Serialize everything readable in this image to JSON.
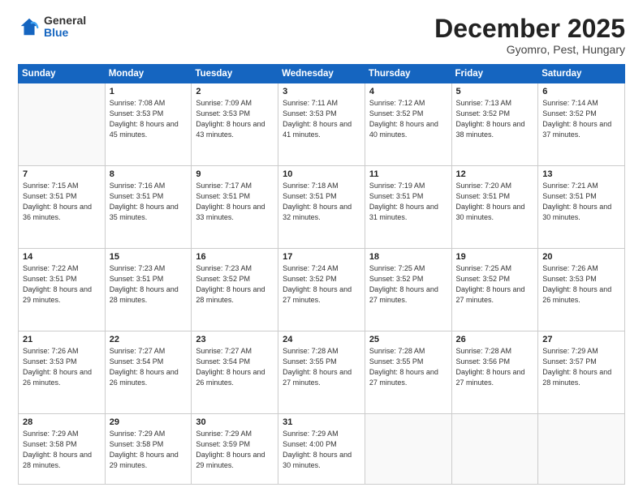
{
  "logo": {
    "general": "General",
    "blue": "Blue"
  },
  "header": {
    "month": "December 2025",
    "location": "Gyomro, Pest, Hungary"
  },
  "weekdays": [
    "Sunday",
    "Monday",
    "Tuesday",
    "Wednesday",
    "Thursday",
    "Friday",
    "Saturday"
  ],
  "weeks": [
    [
      {
        "day": "",
        "sunrise": "",
        "sunset": "",
        "daylight": "",
        "empty": true
      },
      {
        "day": "1",
        "sunrise": "Sunrise: 7:08 AM",
        "sunset": "Sunset: 3:53 PM",
        "daylight": "Daylight: 8 hours and 45 minutes."
      },
      {
        "day": "2",
        "sunrise": "Sunrise: 7:09 AM",
        "sunset": "Sunset: 3:53 PM",
        "daylight": "Daylight: 8 hours and 43 minutes."
      },
      {
        "day": "3",
        "sunrise": "Sunrise: 7:11 AM",
        "sunset": "Sunset: 3:53 PM",
        "daylight": "Daylight: 8 hours and 41 minutes."
      },
      {
        "day": "4",
        "sunrise": "Sunrise: 7:12 AM",
        "sunset": "Sunset: 3:52 PM",
        "daylight": "Daylight: 8 hours and 40 minutes."
      },
      {
        "day": "5",
        "sunrise": "Sunrise: 7:13 AM",
        "sunset": "Sunset: 3:52 PM",
        "daylight": "Daylight: 8 hours and 38 minutes."
      },
      {
        "day": "6",
        "sunrise": "Sunrise: 7:14 AM",
        "sunset": "Sunset: 3:52 PM",
        "daylight": "Daylight: 8 hours and 37 minutes."
      }
    ],
    [
      {
        "day": "7",
        "sunrise": "Sunrise: 7:15 AM",
        "sunset": "Sunset: 3:51 PM",
        "daylight": "Daylight: 8 hours and 36 minutes."
      },
      {
        "day": "8",
        "sunrise": "Sunrise: 7:16 AM",
        "sunset": "Sunset: 3:51 PM",
        "daylight": "Daylight: 8 hours and 35 minutes."
      },
      {
        "day": "9",
        "sunrise": "Sunrise: 7:17 AM",
        "sunset": "Sunset: 3:51 PM",
        "daylight": "Daylight: 8 hours and 33 minutes."
      },
      {
        "day": "10",
        "sunrise": "Sunrise: 7:18 AM",
        "sunset": "Sunset: 3:51 PM",
        "daylight": "Daylight: 8 hours and 32 minutes."
      },
      {
        "day": "11",
        "sunrise": "Sunrise: 7:19 AM",
        "sunset": "Sunset: 3:51 PM",
        "daylight": "Daylight: 8 hours and 31 minutes."
      },
      {
        "day": "12",
        "sunrise": "Sunrise: 7:20 AM",
        "sunset": "Sunset: 3:51 PM",
        "daylight": "Daylight: 8 hours and 30 minutes."
      },
      {
        "day": "13",
        "sunrise": "Sunrise: 7:21 AM",
        "sunset": "Sunset: 3:51 PM",
        "daylight": "Daylight: 8 hours and 30 minutes."
      }
    ],
    [
      {
        "day": "14",
        "sunrise": "Sunrise: 7:22 AM",
        "sunset": "Sunset: 3:51 PM",
        "daylight": "Daylight: 8 hours and 29 minutes."
      },
      {
        "day": "15",
        "sunrise": "Sunrise: 7:23 AM",
        "sunset": "Sunset: 3:51 PM",
        "daylight": "Daylight: 8 hours and 28 minutes."
      },
      {
        "day": "16",
        "sunrise": "Sunrise: 7:23 AM",
        "sunset": "Sunset: 3:52 PM",
        "daylight": "Daylight: 8 hours and 28 minutes."
      },
      {
        "day": "17",
        "sunrise": "Sunrise: 7:24 AM",
        "sunset": "Sunset: 3:52 PM",
        "daylight": "Daylight: 8 hours and 27 minutes."
      },
      {
        "day": "18",
        "sunrise": "Sunrise: 7:25 AM",
        "sunset": "Sunset: 3:52 PM",
        "daylight": "Daylight: 8 hours and 27 minutes."
      },
      {
        "day": "19",
        "sunrise": "Sunrise: 7:25 AM",
        "sunset": "Sunset: 3:52 PM",
        "daylight": "Daylight: 8 hours and 27 minutes."
      },
      {
        "day": "20",
        "sunrise": "Sunrise: 7:26 AM",
        "sunset": "Sunset: 3:53 PM",
        "daylight": "Daylight: 8 hours and 26 minutes."
      }
    ],
    [
      {
        "day": "21",
        "sunrise": "Sunrise: 7:26 AM",
        "sunset": "Sunset: 3:53 PM",
        "daylight": "Daylight: 8 hours and 26 minutes."
      },
      {
        "day": "22",
        "sunrise": "Sunrise: 7:27 AM",
        "sunset": "Sunset: 3:54 PM",
        "daylight": "Daylight: 8 hours and 26 minutes."
      },
      {
        "day": "23",
        "sunrise": "Sunrise: 7:27 AM",
        "sunset": "Sunset: 3:54 PM",
        "daylight": "Daylight: 8 hours and 26 minutes."
      },
      {
        "day": "24",
        "sunrise": "Sunrise: 7:28 AM",
        "sunset": "Sunset: 3:55 PM",
        "daylight": "Daylight: 8 hours and 27 minutes."
      },
      {
        "day": "25",
        "sunrise": "Sunrise: 7:28 AM",
        "sunset": "Sunset: 3:55 PM",
        "daylight": "Daylight: 8 hours and 27 minutes."
      },
      {
        "day": "26",
        "sunrise": "Sunrise: 7:28 AM",
        "sunset": "Sunset: 3:56 PM",
        "daylight": "Daylight: 8 hours and 27 minutes."
      },
      {
        "day": "27",
        "sunrise": "Sunrise: 7:29 AM",
        "sunset": "Sunset: 3:57 PM",
        "daylight": "Daylight: 8 hours and 28 minutes."
      }
    ],
    [
      {
        "day": "28",
        "sunrise": "Sunrise: 7:29 AM",
        "sunset": "Sunset: 3:58 PM",
        "daylight": "Daylight: 8 hours and 28 minutes."
      },
      {
        "day": "29",
        "sunrise": "Sunrise: 7:29 AM",
        "sunset": "Sunset: 3:58 PM",
        "daylight": "Daylight: 8 hours and 29 minutes."
      },
      {
        "day": "30",
        "sunrise": "Sunrise: 7:29 AM",
        "sunset": "Sunset: 3:59 PM",
        "daylight": "Daylight: 8 hours and 29 minutes."
      },
      {
        "day": "31",
        "sunrise": "Sunrise: 7:29 AM",
        "sunset": "Sunset: 4:00 PM",
        "daylight": "Daylight: 8 hours and 30 minutes."
      },
      {
        "day": "",
        "empty": true
      },
      {
        "day": "",
        "empty": true
      },
      {
        "day": "",
        "empty": true
      }
    ]
  ]
}
